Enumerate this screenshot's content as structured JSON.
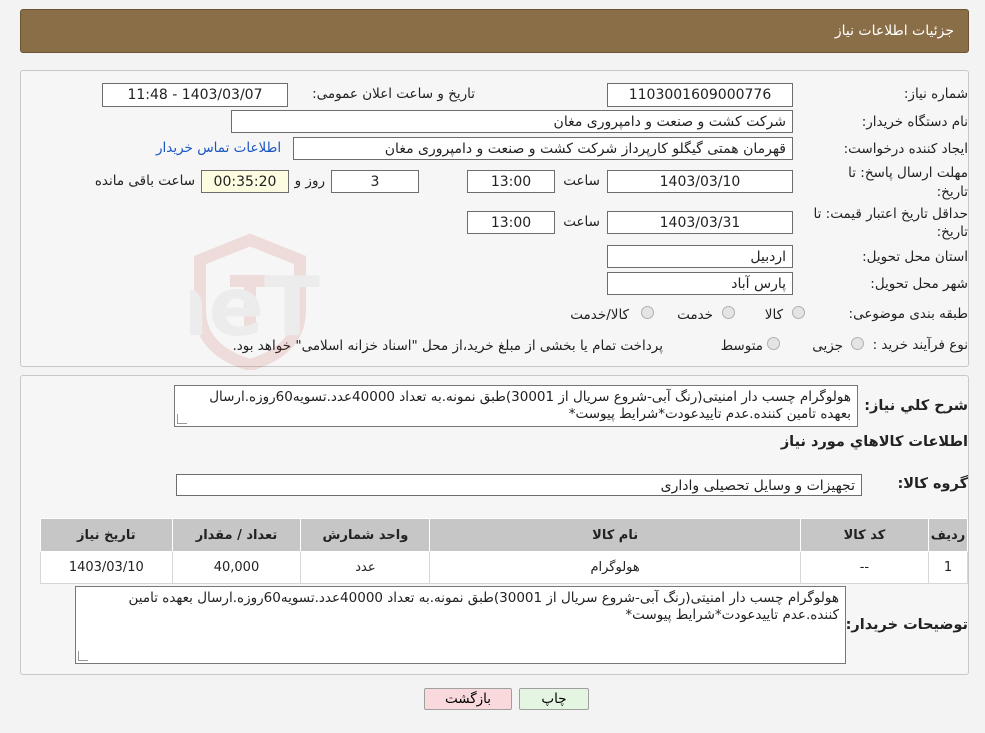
{
  "header": {
    "title": "جزئیات اطلاعات نیاز"
  },
  "fields": {
    "need_number_label": "شماره نیاز:",
    "need_number": "1103001609000776",
    "announce_label": "تاریخ و ساعت اعلان عمومی:",
    "announce_value": "1403/03/07 - 11:48",
    "buyer_org_label": "نام دستگاه خریدار:",
    "buyer_org": "شرکت کشت و صنعت و دامپروری مغان",
    "creator_label": "ایجاد کننده درخواست:",
    "creator": "قهرمان همتی گیگلو کارپرداز شرکت کشت و صنعت و دامپروری مغان",
    "contact_link": "اطلاعات تماس خریدار",
    "deadline_label_1": "مهلت ارسال پاسخ: تا",
    "deadline_label_2": "تاریخ:",
    "deadline_date": "1403/03/10",
    "time_label": "ساعت",
    "deadline_time": "13:00",
    "days_value": "3",
    "days_label": "روز و",
    "remaining_time": "00:35:20",
    "remaining_label": "ساعت باقی مانده",
    "validity_label_1": "حداقل تاریخ اعتبار قیمت: تا",
    "validity_label_2": "تاریخ:",
    "validity_date": "1403/03/31",
    "validity_time": "13:00",
    "province_label": "استان محل تحویل:",
    "province": "اردبیل",
    "city_label": "شهر محل تحویل:",
    "city": "پارس آباد",
    "category_label": "طبقه بندی موضوعی:",
    "category_options": [
      "کالا",
      "خدمت",
      "کالا/خدمت"
    ],
    "process_label": "نوع فرآیند خرید :",
    "process_options": [
      "جزیی",
      "متوسط"
    ],
    "process_note": "پرداخت تمام یا بخشی از مبلغ خرید،از محل \"اسناد خزانه اسلامی\" خواهد بود."
  },
  "summary": {
    "label": "شرح کلي نياز:",
    "text": "هولوگرام چسب دار امنیتی(رنگ آبی-شروع سریال از 30001)طبق نمونه.به تعداد 40000عدد.تسویه60روزه.ارسال بعهده تامین کننده.عدم تاییدعودت*شرایط پیوست*"
  },
  "goods": {
    "title": "اطلاعات کالاهاي مورد نياز",
    "group_label": "گروه کالا:",
    "group_value": "تجهیزات و وسایل تحصیلی واداری",
    "columns": [
      "رديف",
      "کد کالا",
      "نام کالا",
      "واحد شمارش",
      "تعداد / مقدار",
      "تاریخ نیاز"
    ],
    "rows": [
      [
        "1",
        "--",
        "هولوگرام",
        "عدد",
        "40,000",
        "1403/03/10"
      ]
    ]
  },
  "buyer_notes": {
    "label": "توضیحات خریدار:",
    "text": "هولوگرام چسب دار امنیتی(رنگ آبی-شروع سریال از 30001)طبق نمونه.به تعداد 40000عدد.تسویه60روزه.ارسال بعهده تامین کننده.عدم تاییدعودت*شرایط پیوست*"
  },
  "buttons": {
    "print": "چاپ",
    "back": "بازگشت"
  },
  "watermark": {
    "text": "AriaTender.neT"
  },
  "colors": {
    "header": "#8a6e47",
    "link": "#1a56c4",
    "back_button": "#f9d9dc",
    "print_button": "#e4f6e2"
  }
}
